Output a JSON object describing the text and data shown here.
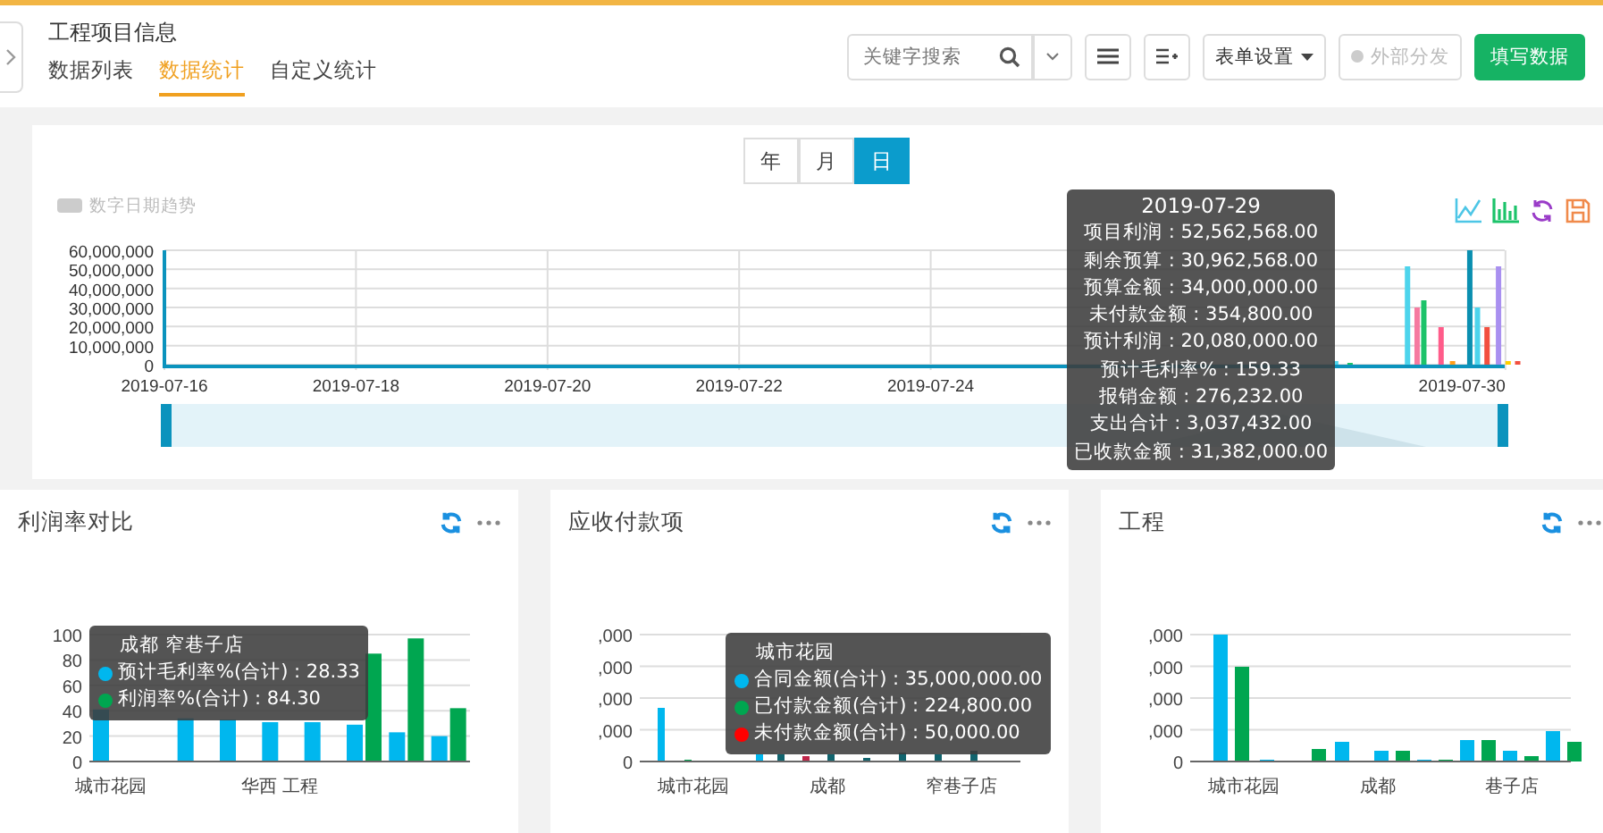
{
  "header": {
    "title": "工程项目信息",
    "tabs": [
      {
        "label": "数据列表",
        "selected": false
      },
      {
        "label": "数据统计",
        "selected": true
      },
      {
        "label": "自定义统计",
        "selected": false
      }
    ],
    "search": {
      "placeholder": "关键字搜索"
    },
    "form_settings_button": "表单设置",
    "share_toggle": {
      "label": "外部分发",
      "disabled": true
    },
    "fill_button": "填写数据"
  },
  "trend": {
    "periods": [
      {
        "label": "年",
        "selected": false
      },
      {
        "label": "月",
        "selected": false
      },
      {
        "label": "日",
        "selected": true
      }
    ],
    "legend": {
      "label": "数字日期趋势",
      "enabled": false
    },
    "y_labels": [
      "60,000,000",
      "50,000,000",
      "40,000,000",
      "30,000,000",
      "20,000,000",
      "10,000,000",
      "0"
    ],
    "x_labels": [
      "2019-07-16",
      "2019-07-18",
      "2019-07-20",
      "2019-07-22",
      "2019-07-24",
      "2019-07-30"
    ],
    "zoom_slider": {
      "level": 1
    },
    "tooltip": {
      "title": "2019-07-29",
      "lines": [
        "项目利润 : 52,562,568.00",
        "剩余预算 : 30,962,568.00",
        "预算金额 : 34,000,000.00",
        "未付款金额 : 354,800.00",
        "预计利润 : 20,080,000.00",
        "预计毛利率% : 159.33",
        "报销金额 : 276,232.00",
        "支出合计 : 3,037,432.00",
        "已收款金额 : 31,382,000.00"
      ]
    }
  },
  "panels": [
    {
      "kind": "chart",
      "title": "利润率对比",
      "chart_data": {
        "type": "bar",
        "categories": [
          "城市花园",
          null,
          null,
          null,
          "华西 工程",
          null,
          null,
          null,
          null
        ],
        "ylim": [
          0,
          100
        ],
        "yticks": [
          0,
          20,
          40,
          60,
          80,
          100
        ],
        "grid": true,
        "series": [
          {
            "name": "预计毛利率%(合计)",
            "color": "#00b7ee",
            "values": [
              41,
              null,
              34,
              33,
              31,
              31,
              29,
              23,
              20
            ]
          },
          {
            "name": "利润率%(合计)",
            "color": "#00a650",
            "values": [
              null,
              null,
              null,
              null,
              null,
              null,
              85,
              97,
              42
            ]
          }
        ]
      },
      "tooltip": {
        "title": "成都 窄巷子店",
        "values": [
          ": 28.33",
          ": 84.30"
        ]
      }
    },
    {
      "kind": "picture",
      "title": "应收付款项",
      "y_labels": [
        ",000",
        ",000",
        ",000",
        ",000",
        "0"
      ],
      "x_labels": [
        "城市花园",
        "成都",
        "窄巷子店"
      ],
      "tooltip": {
        "title": "城市花园",
        "items": [
          {
            "color": "#00b7ee",
            "text": "合同金额(合计) : 35,000,000.00"
          },
          {
            "color": "#00a650",
            "text": "已付款金额(合计) : 224,800.00"
          },
          {
            "color": "#ff0000",
            "text": "未付款金额(合计) : 50,000.00"
          }
        ]
      }
    },
    {
      "kind": "picture",
      "title": "工程",
      "y_labels": [
        ",000",
        ",000",
        ",000",
        ",000",
        "0"
      ],
      "x_labels": [
        "城市花园",
        "成都",
        "巷子店"
      ]
    }
  ]
}
